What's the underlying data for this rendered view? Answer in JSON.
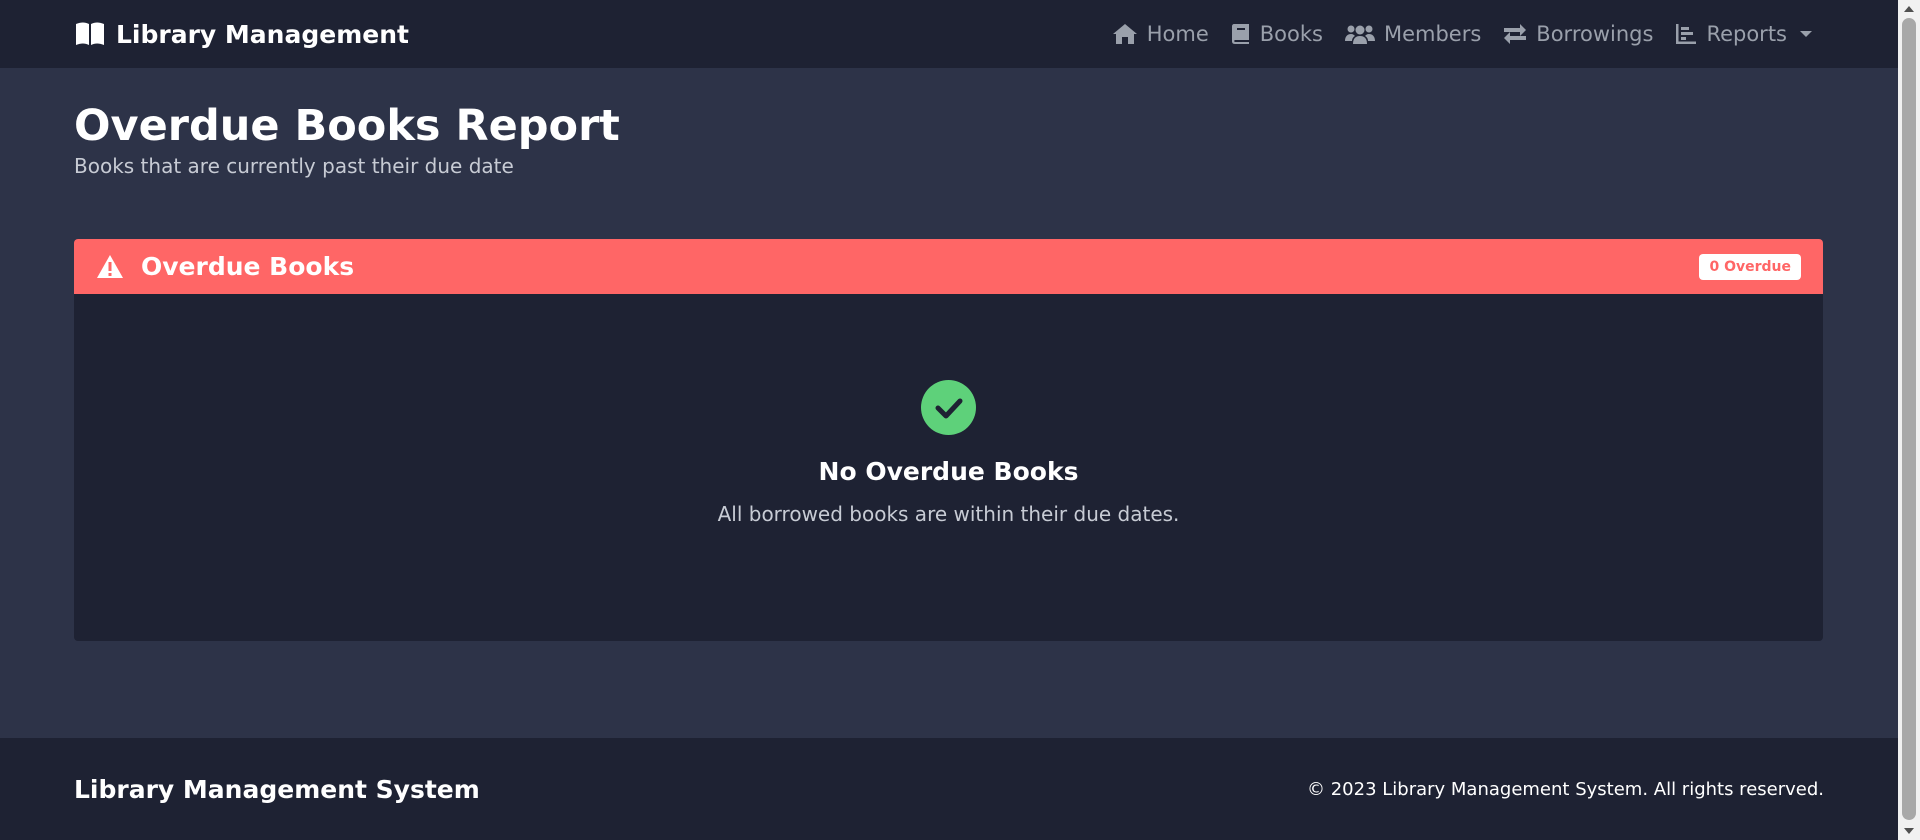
{
  "navbar": {
    "brand": "Library Management",
    "links": [
      {
        "label": "Home",
        "icon": "home-icon"
      },
      {
        "label": "Books",
        "icon": "book-icon"
      },
      {
        "label": "Members",
        "icon": "users-icon"
      },
      {
        "label": "Borrowings",
        "icon": "exchange-icon"
      },
      {
        "label": "Reports",
        "icon": "chart-icon"
      }
    ]
  },
  "header": {
    "title": "Overdue Books Report",
    "subtitle": "Books that are currently past their due date"
  },
  "card": {
    "title": "Overdue Books",
    "badge": "0 Overdue",
    "empty_title": "No Overdue Books",
    "empty_text": "All borrowed books are within their due dates."
  },
  "footer": {
    "brand": "Library Management System",
    "copyright": "© 2023 Library Management System. All rights reserved."
  },
  "colors": {
    "navbar_bg": "#1e2233",
    "page_bg": "#2d3348",
    "danger": "#ff6666",
    "success": "#5ed17a",
    "muted": "#9aa0ab"
  }
}
